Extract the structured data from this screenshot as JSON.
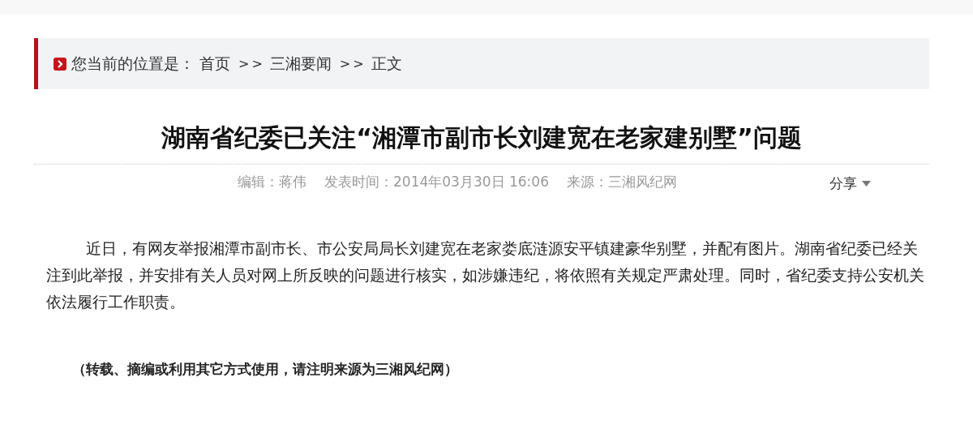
{
  "breadcrumb": {
    "label": "您当前的位置是：",
    "crumbs": [
      {
        "text": "首页"
      },
      {
        "separator": ">>",
        "text": "三湘要闻"
      },
      {
        "separator": ">>",
        "text": "正文"
      }
    ]
  },
  "article": {
    "title": "湖南省纪委已关注“湘潭市副市长刘建宽在老家建别墅”问题",
    "meta": [
      "编辑：蒋伟",
      "发表时间：2014年03月30日 16:06",
      "来源：三湘风纪网"
    ],
    "share": "分享",
    "paragraphs": [
      "近日，有网友举报湘潭市副市长、市公安局局长刘建宽在老家娄底涟源安平镇建豪华别墅，并配有图片。湖南省纪委已经关注到此举报，并安排有关人员对网上所反映的问题进行核实，如涉嫌违纪，将依照有关规定严肃处理。同时，省纪委支持公安机关依法履行工作职责。"
    ],
    "note": "（转载、摘编或利用其它方式使用，请注明来源为三湘风纪网）"
  }
}
